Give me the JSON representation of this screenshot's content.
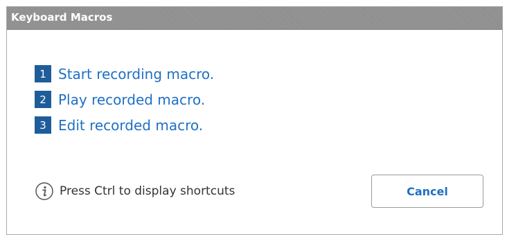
{
  "window": {
    "title": "Keyboard Macros"
  },
  "macros": [
    {
      "number": "1",
      "label": "Start recording macro."
    },
    {
      "number": "2",
      "label": "Play recorded macro."
    },
    {
      "number": "3",
      "label": "Edit recorded macro."
    }
  ],
  "hint": {
    "icon": "info-icon",
    "text": "Press Ctrl to display shortcuts"
  },
  "buttons": {
    "cancel_label": "Cancel"
  },
  "colors": {
    "accent": "#1f6fc4",
    "badge": "#1f5d9a",
    "titlebar": "#8e8e8e"
  }
}
